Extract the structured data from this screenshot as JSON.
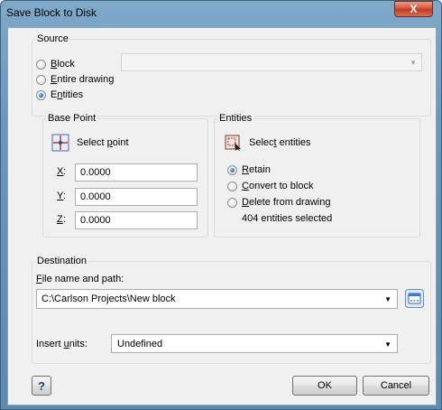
{
  "window": {
    "title": "Save Block to Disk",
    "close_label": "X"
  },
  "source": {
    "group_label": "Source",
    "options": {
      "block": "Block",
      "entire_drawing": "Entire drawing",
      "entities": "Entities"
    },
    "selected": "entities",
    "block_combo_value": ""
  },
  "base_point": {
    "group_label": "Base Point",
    "select_point_label": "Select point",
    "x_label": "X:",
    "x_value": "0.0000",
    "y_label": "Y:",
    "y_value": "0.0000",
    "z_label": "Z:",
    "z_value": "0.0000"
  },
  "entities": {
    "group_label": "Entities",
    "select_label": "Select entities",
    "options": {
      "retain": "Retain",
      "convert": "Convert to block",
      "delete": "Delete from drawing"
    },
    "selected": "retain",
    "status": "404 entities selected"
  },
  "destination": {
    "group_label": "Destination",
    "file_label": "File name and path:",
    "file_value": "C:\\Carlson Projects\\New block",
    "units_label": "Insert units:",
    "units_value": "Undefined"
  },
  "buttons": {
    "help": "?",
    "ok": "OK",
    "cancel": "Cancel"
  },
  "icons": {
    "select_point": "crosshair-point-icon",
    "select_entities": "select-entities-icon",
    "browse": "browse-folder-icon"
  }
}
